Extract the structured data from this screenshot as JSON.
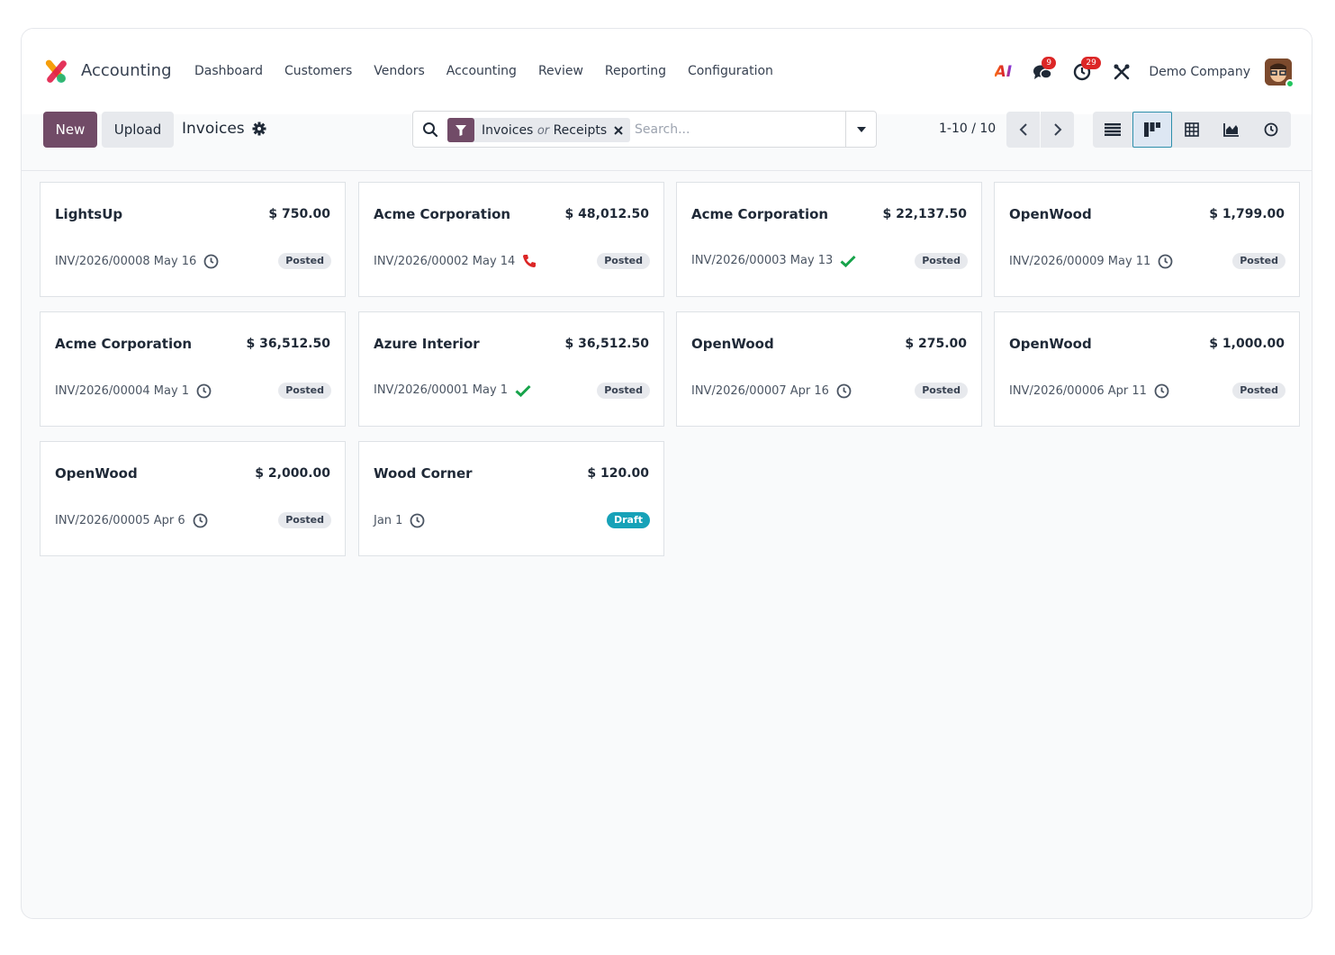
{
  "app": {
    "name": "Accounting"
  },
  "nav": [
    {
      "label": "Dashboard"
    },
    {
      "label": "Customers"
    },
    {
      "label": "Vendors"
    },
    {
      "label": "Accounting"
    },
    {
      "label": "Review"
    },
    {
      "label": "Reporting"
    },
    {
      "label": "Configuration"
    }
  ],
  "systray": {
    "ai_label": "AI",
    "messages_count": "9",
    "activities_count": "29",
    "company": "Demo Company"
  },
  "control": {
    "new_label": "New",
    "upload_label": "Upload",
    "breadcrumb": "Invoices"
  },
  "search": {
    "facet_left": "Invoices",
    "facet_sep": "or",
    "facet_right": "Receipts",
    "placeholder": "Search..."
  },
  "pager": {
    "value": "1-10 / 10"
  },
  "cards": [
    {
      "partner": "LightsUp",
      "amount": "$ 750.00",
      "meta": "INV/2026/00008 May 16",
      "activity": "clock",
      "status": "Posted",
      "status_type": "posted"
    },
    {
      "partner": "Acme Corporation",
      "amount": "$ 48,012.50",
      "meta": "INV/2026/00002 May 14",
      "activity": "phone",
      "status": "Posted",
      "status_type": "posted"
    },
    {
      "partner": "Acme Corporation",
      "amount": "$ 22,137.50",
      "meta": "INV/2026/00003 May 13",
      "activity": "check",
      "status": "Posted",
      "status_type": "posted"
    },
    {
      "partner": "OpenWood",
      "amount": "$ 1,799.00",
      "meta": "INV/2026/00009 May 11",
      "activity": "clock",
      "status": "Posted",
      "status_type": "posted"
    },
    {
      "partner": "Acme Corporation",
      "amount": "$ 36,512.50",
      "meta": "INV/2026/00004 May 1",
      "activity": "clock",
      "status": "Posted",
      "status_type": "posted"
    },
    {
      "partner": "Azure Interior",
      "amount": "$ 36,512.50",
      "meta": "INV/2026/00001 May 1",
      "activity": "check",
      "status": "Posted",
      "status_type": "posted"
    },
    {
      "partner": "OpenWood",
      "amount": "$ 275.00",
      "meta": "INV/2026/00007 Apr 16",
      "activity": "clock",
      "status": "Posted",
      "status_type": "posted"
    },
    {
      "partner": "OpenWood",
      "amount": "$ 1,000.00",
      "meta": "INV/2026/00006 Apr 11",
      "activity": "clock",
      "status": "Posted",
      "status_type": "posted"
    },
    {
      "partner": "OpenWood",
      "amount": "$ 2,000.00",
      "meta": "INV/2026/00005 Apr 6",
      "activity": "clock",
      "status": "Posted",
      "status_type": "posted"
    },
    {
      "partner": "Wood Corner",
      "amount": "$ 120.00",
      "meta": "Jan 1",
      "activity": "clock",
      "status": "Draft",
      "status_type": "draft"
    }
  ],
  "colors": {
    "brand": "#714b67",
    "draft": "#17a2b8",
    "active_view": "#2d8fab"
  }
}
